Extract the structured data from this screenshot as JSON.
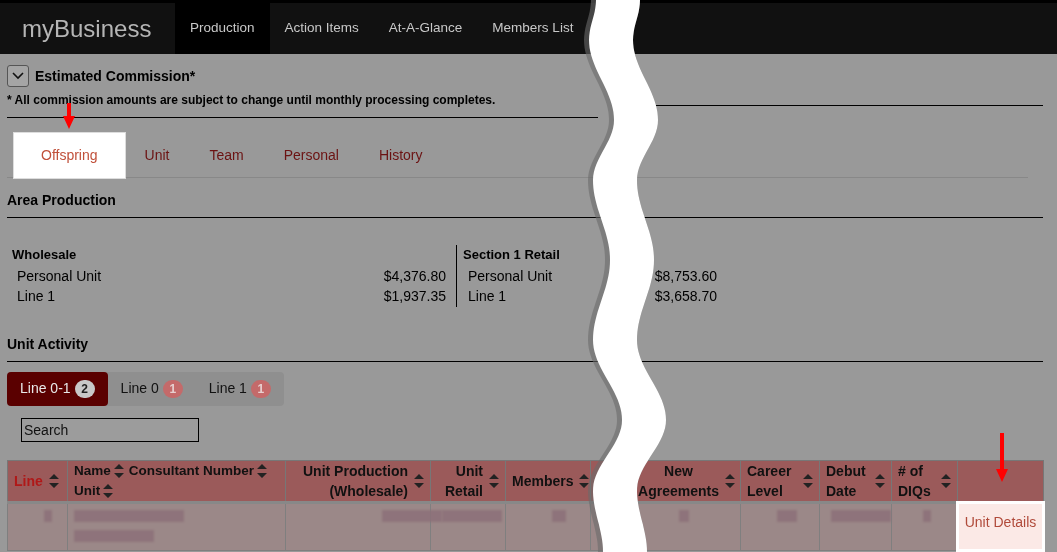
{
  "nav": {
    "logo": "myBusiness",
    "items": [
      {
        "label": "Production",
        "selected": true
      },
      {
        "label": "Action Items",
        "selected": false
      },
      {
        "label": "At-A-Glance",
        "selected": false
      },
      {
        "label": "Members List",
        "selected": false
      }
    ]
  },
  "commission": {
    "title": "Estimated Commission*",
    "note": "* All commission amounts are subject to change until monthly processing completes."
  },
  "tabs": [
    {
      "label": "Offspring",
      "selected": true
    },
    {
      "label": "Unit",
      "selected": false
    },
    {
      "label": "Team",
      "selected": false
    },
    {
      "label": "Personal",
      "selected": false
    },
    {
      "label": "History",
      "selected": false
    }
  ],
  "area_production": {
    "title": "Area Production",
    "groups": [
      {
        "title": "Wholesale",
        "rows": [
          {
            "label": "Personal Unit",
            "value": "$4,376.80"
          },
          {
            "label": "Line 1",
            "value": "$1,937.35"
          }
        ]
      },
      {
        "title": "Section 1 Retail",
        "rows": [
          {
            "label": "Personal Unit",
            "value": "$8,753.60"
          },
          {
            "label": "Line 1",
            "value": "$3,658.70"
          }
        ]
      }
    ]
  },
  "unit_activity": {
    "title": "Unit Activity",
    "filters": [
      {
        "label": "Line 0-1",
        "count": "2",
        "selected": true
      },
      {
        "label": "Line 0",
        "count": "1",
        "selected": false
      },
      {
        "label": "Line 1",
        "count": "1",
        "selected": false
      }
    ],
    "search": {
      "placeholder": "Search"
    },
    "table": {
      "columns": [
        {
          "parts": [
            "Line"
          ],
          "sorted": true
        },
        {
          "parts": [
            "Name",
            "Consultant Number",
            "Unit"
          ],
          "sorted": false
        },
        {
          "parts": [
            "Unit Production (Wholesale)"
          ],
          "sorted": false
        },
        {
          "parts": [
            "Unit Retail"
          ],
          "sorted": false
        },
        {
          "parts": [
            "Members"
          ],
          "sorted": false
        },
        {},
        {
          "parts": [
            "New Agreements"
          ],
          "sorted": false
        },
        {
          "parts": [
            "Career Level"
          ],
          "sorted": false
        },
        {
          "parts": [
            "Debut Date"
          ],
          "sorted": false
        },
        {
          "parts": [
            "# of DIQs"
          ],
          "sorted": false
        },
        {}
      ],
      "rows": [
        {
          "link": "Unit Details"
        }
      ]
    }
  }
}
